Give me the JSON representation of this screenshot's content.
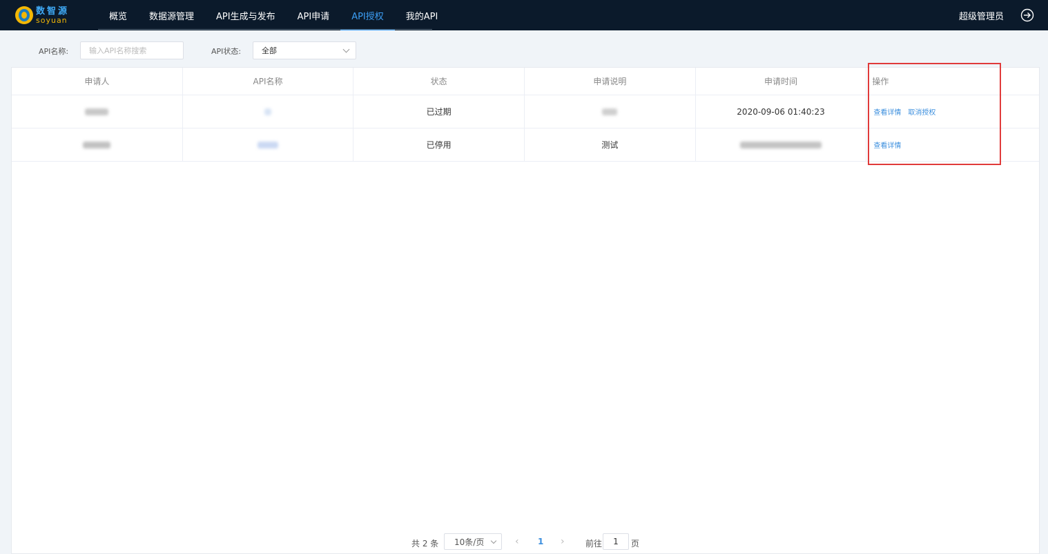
{
  "logo": {
    "cn": "数智源",
    "en": "soyuan"
  },
  "nav": {
    "items": [
      {
        "label": "概览"
      },
      {
        "label": "数据源管理"
      },
      {
        "label": "API生成与发布"
      },
      {
        "label": "API申请"
      },
      {
        "label": "API授权",
        "active": true
      },
      {
        "label": "我的API"
      }
    ]
  },
  "user": {
    "name": "超级管理员"
  },
  "filters": {
    "name_label": "API名称:",
    "name_placeholder": "输入API名称搜索",
    "status_label": "API状态:",
    "status_value": "全部"
  },
  "table": {
    "columns": [
      "申请人",
      "API名称",
      "状态",
      "申请说明",
      "申请时间",
      "操作"
    ],
    "rows": [
      {
        "applicant": "",
        "api_name": "",
        "status": "已过期",
        "description": "",
        "time": "2020-09-06 01:40:23",
        "actions": [
          "查看详情",
          "取消授权"
        ]
      },
      {
        "applicant": "",
        "api_name": "",
        "status": "已停用",
        "description": "测试",
        "time": "",
        "actions": [
          "查看详情"
        ]
      }
    ]
  },
  "pagination": {
    "total": "共 2 条",
    "page_size": "10条/页",
    "current_page": "1",
    "goto_label": "前往",
    "goto_value": "1",
    "page_suffix": "页"
  },
  "colors": {
    "nav_bg": "#0b1a2b",
    "accent": "#3c9ef5",
    "highlight": "#e03a3a"
  }
}
